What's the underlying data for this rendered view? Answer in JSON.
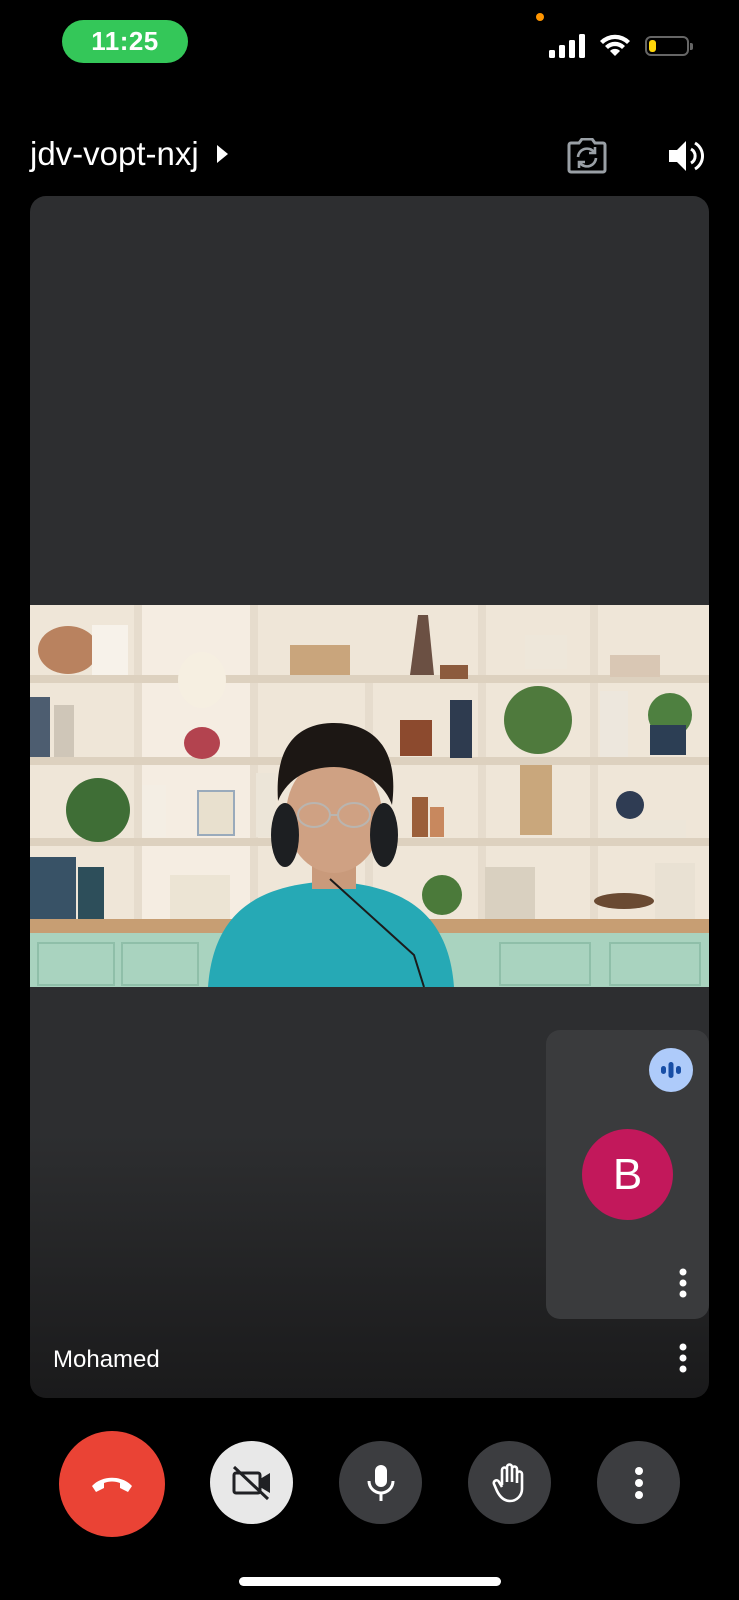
{
  "status_bar": {
    "time": "11:25",
    "icons": [
      "cellular-signal-icon",
      "wifi-icon",
      "battery-icon"
    ],
    "battery_level": 0.2,
    "battery_color": "#ffd60a"
  },
  "header": {
    "meeting_code": "jdv-vopt-nxj",
    "switch_camera_icon": "switch-camera-icon",
    "speaker_icon": "speaker-icon"
  },
  "main_tile": {
    "participant_name": "Mohamed",
    "background_color": "#2d2e30"
  },
  "self_tile": {
    "avatar_letter": "B",
    "avatar_color": "#c2185b",
    "audio_badge_color": "#aecbfa"
  },
  "controls": {
    "end_call_color": "#ea4335",
    "buttons": [
      "end-call-icon",
      "camera-off-icon",
      "mic-icon",
      "raise-hand-icon",
      "more-vert-icon"
    ]
  }
}
